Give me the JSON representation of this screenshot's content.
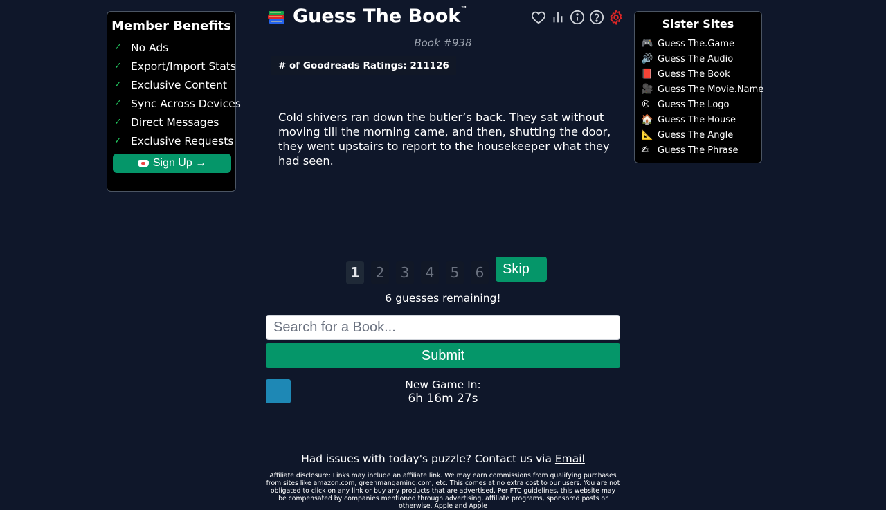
{
  "member_benefits": {
    "title": "Member Benefits",
    "items": [
      {
        "check": "✓",
        "label": "No Ads"
      },
      {
        "check": "✓",
        "label": "Export/Import Stats"
      },
      {
        "check": "✓",
        "label": "Exclusive Content"
      },
      {
        "check": "✓",
        "label": "Sync Across Devices"
      },
      {
        "check": "✓",
        "label": "Direct Messages"
      },
      {
        "check": "✓",
        "label": "Exclusive Requests"
      }
    ],
    "signup_label": "Sign Up →"
  },
  "header": {
    "title": "Guess The Book",
    "trademark": "™",
    "icons": [
      "heart-icon",
      "stats-icon",
      "info-icon",
      "help-icon",
      "settings-icon"
    ]
  },
  "puzzle": {
    "book_number": "Book #938",
    "ratings": "# of Goodreads Ratings: 211126",
    "quote": "Cold shivers ran down the butler’s back. They sat without moving till the morning came, and then, shutting the door, they went upstairs to report to the housekeeper what they had seen."
  },
  "guesses": {
    "numbers": [
      "1",
      "2",
      "3",
      "4",
      "5",
      "6"
    ],
    "active": 1,
    "skip_label": "Skip",
    "remaining": "6 guesses remaining!"
  },
  "search": {
    "placeholder": "Search for a Book..."
  },
  "submit_label": "Submit",
  "new_game": {
    "label": "New Game In:",
    "countdown": "6h 16m 27s"
  },
  "footer": {
    "issues_text": "Had issues with today's puzzle? Contact us via ",
    "email_link": "Email",
    "disclosure": "Affiliate disclosure: Links may include an affiliate link. We may earn commissions from qualifying purchases from sites like amazon.com, greenmangaming.com, etc. This comes at no extra cost to our users. You are not obligated to click on any link or buy any products that are advertised. Per FTC guidelines, this website may be compensated by companies mentioned through advertising, affiliate programs, sponsored posts or otherwise. Apple and Apple"
  },
  "sister_sites": {
    "title": "Sister Sites",
    "items": [
      {
        "emoji": "🎮",
        "label": "Guess The.Game"
      },
      {
        "emoji": "🔊",
        "label": "Guess The Audio"
      },
      {
        "emoji": "📕",
        "label": "Guess The Book"
      },
      {
        "emoji": "🎥",
        "label": "Guess The Movie.Name"
      },
      {
        "emoji": "®",
        "label": "Guess The Logo"
      },
      {
        "emoji": "🏠",
        "label": "Guess The House"
      },
      {
        "emoji": "📐",
        "label": "Guess The Angle"
      },
      {
        "emoji": "✍",
        "label": "Guess The Phrase"
      }
    ]
  },
  "colors": {
    "background": "#0f172a",
    "accent_green": "#059669",
    "square_blue": "#1e88b5",
    "settings_red": "#dc2626"
  }
}
